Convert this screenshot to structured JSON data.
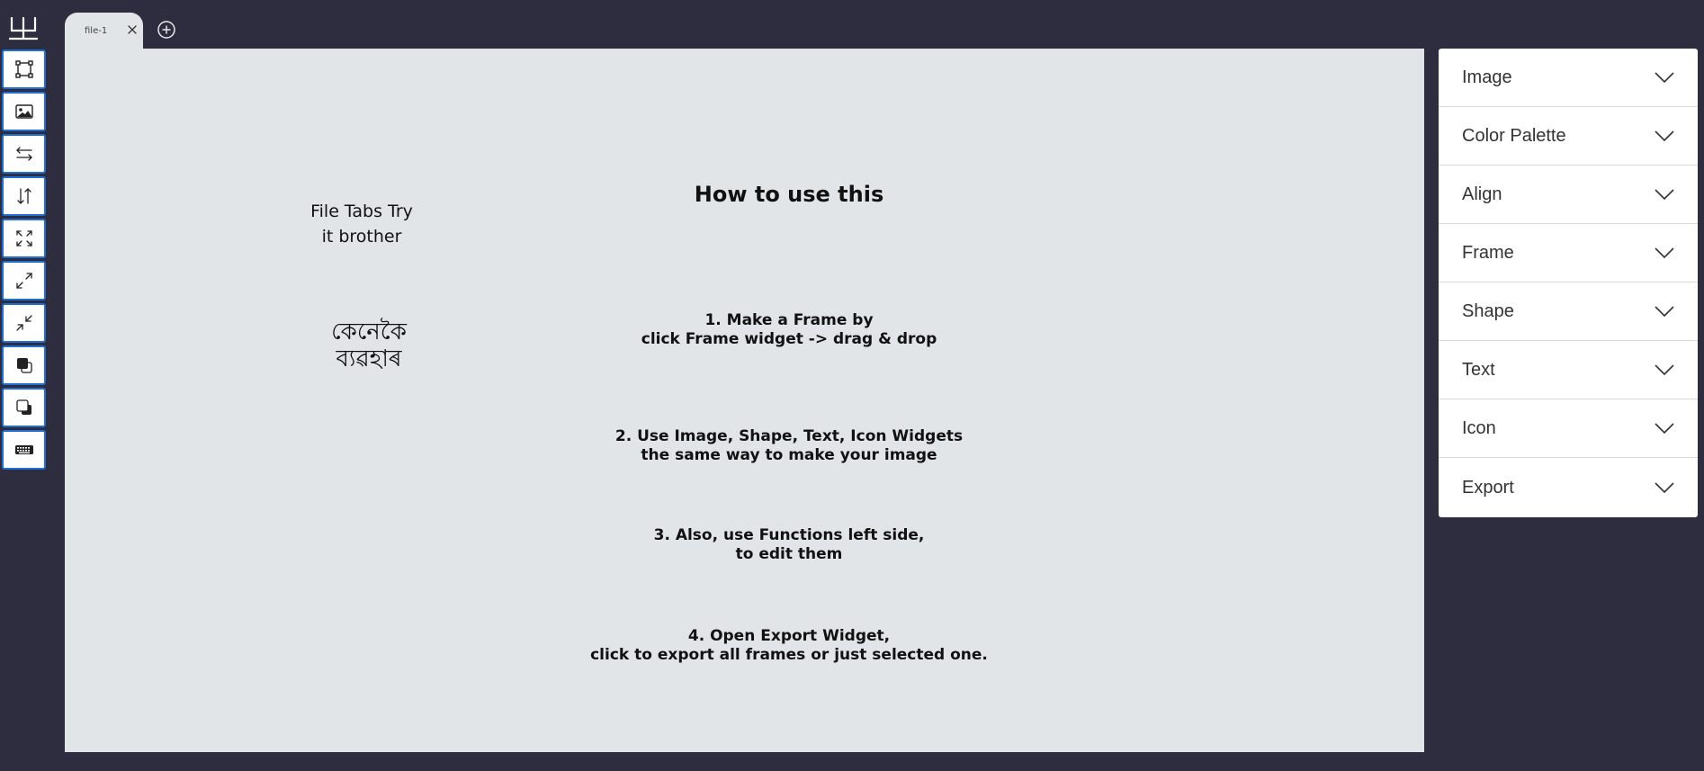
{
  "app": {
    "logo_icon": "trident-logo-icon"
  },
  "toolbar": {
    "items": [
      {
        "icon": "frame-select-icon"
      },
      {
        "icon": "image-icon"
      },
      {
        "icon": "flip-horizontal-icon"
      },
      {
        "icon": "flip-vertical-icon"
      },
      {
        "icon": "expand-corners-icon"
      },
      {
        "icon": "maximize-diagonal-icon"
      },
      {
        "icon": "minimize-diagonal-icon"
      },
      {
        "icon": "bring-forward-icon"
      },
      {
        "icon": "send-backward-icon"
      },
      {
        "icon": "keyboard-icon"
      }
    ]
  },
  "tabs": [
    {
      "label": "file-1"
    }
  ],
  "canvas": {
    "side_note_line1": "File Tabs Try",
    "side_note_line2": "it brother",
    "assamese_line1": "কেনেকৈ",
    "assamese_line2": "ব্যৱহাৰ",
    "heading": "How to use this",
    "steps": [
      {
        "line1": "1. Make a Frame by",
        "line2": "click Frame widget -> drag & drop"
      },
      {
        "line1": "2. Use Image, Shape, Text, Icon Widgets",
        "line2": "the same way to make your image"
      },
      {
        "line1": "3. Also, use Functions left side,",
        "line2": "to edit them"
      },
      {
        "line1": "4. Open Export Widget,",
        "line2": "click to export all frames or just selected one."
      }
    ]
  },
  "panel": {
    "items": [
      {
        "label": "Image"
      },
      {
        "label": "Color Palette"
      },
      {
        "label": "Align"
      },
      {
        "label": "Frame"
      },
      {
        "label": "Shape"
      },
      {
        "label": "Text"
      },
      {
        "label": "Icon"
      },
      {
        "label": "Export"
      }
    ]
  },
  "colors": {
    "background": "#2e2d3f",
    "canvas": "#e2e5e8",
    "tool_border": "#1f6fd1",
    "panel": "#ffffff"
  }
}
